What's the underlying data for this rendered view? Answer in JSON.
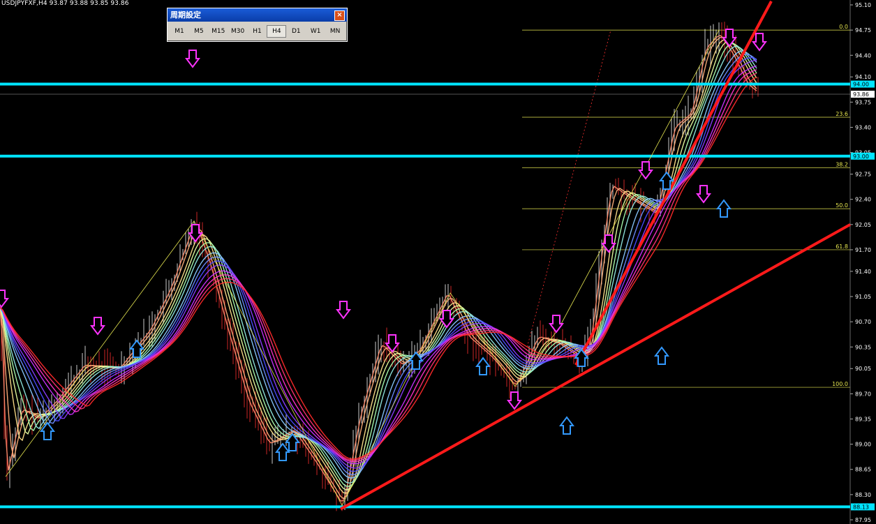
{
  "window": {
    "symbol_header": "USDJPYFXF,H4  93.87 93.88 93.85 93.86"
  },
  "period_panel": {
    "title": "周期設定",
    "close_glyph": "×",
    "buttons": [
      {
        "label": "M1",
        "active": false
      },
      {
        "label": "M5",
        "active": false
      },
      {
        "label": "M15",
        "active": false
      },
      {
        "label": "M30",
        "active": false
      },
      {
        "label": "H1",
        "active": false
      },
      {
        "label": "H4",
        "active": true
      },
      {
        "label": "D1",
        "active": false
      },
      {
        "label": "W1",
        "active": false
      },
      {
        "label": "MN",
        "active": false
      }
    ]
  },
  "price_axis": {
    "labels": [
      "95.10",
      "94.75",
      "94.40",
      "94.10",
      "93.75",
      "93.40",
      "93.05",
      "92.75",
      "92.40",
      "92.05",
      "91.70",
      "91.40",
      "91.05",
      "90.70",
      "90.35",
      "90.05",
      "89.70",
      "89.35",
      "89.00",
      "88.65",
      "88.30",
      "87.95"
    ],
    "current_price": "93.86",
    "colors": {
      "current_bg": "#ffffff",
      "current_text": "#000000"
    }
  },
  "horizontal_lines": [
    {
      "price_label": "94.00",
      "color": "#00e5ff"
    },
    {
      "price_label": "93.00",
      "color": "#00e5ff"
    },
    {
      "price_label": "88.13",
      "color": "#00e5ff"
    }
  ],
  "fibonacci": {
    "color": "#e6e650",
    "levels": [
      {
        "label": "0.0",
        "price": 94.75
      },
      {
        "label": "23.6",
        "price": 93.54
      },
      {
        "label": "38.2",
        "price": 92.84
      },
      {
        "label": "50.0",
        "price": 92.27
      },
      {
        "label": "61.8",
        "price": 91.7
      },
      {
        "label": "100.0",
        "price": 89.79
      }
    ]
  },
  "colors": {
    "background": "#000000",
    "trendline": "#ff1a1a",
    "arrow_down": "#ff33ff",
    "arrow_up": "#3399ff",
    "axis_text": "#ffffff"
  },
  "markers": {
    "down_arrows": 17,
    "up_arrows": 11
  }
}
